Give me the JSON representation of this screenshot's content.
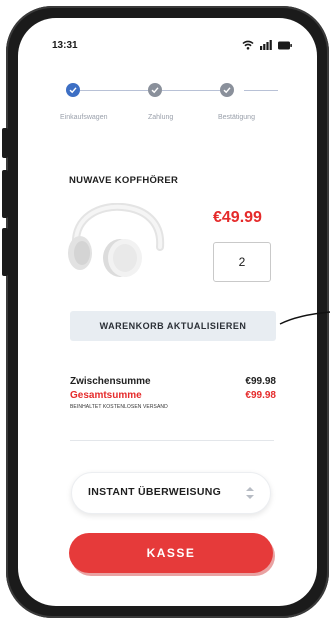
{
  "status_bar": {
    "time": "13:31"
  },
  "stepper": {
    "steps": [
      {
        "label": "Einkaufswagen",
        "state": "completed"
      },
      {
        "label": "Zahlung",
        "state": "pending"
      },
      {
        "label": "Bestätigung",
        "state": "pending"
      }
    ]
  },
  "product": {
    "name": "NUWAVE KOPFHÖRER",
    "price": "€49.99",
    "quantity": "2",
    "image_icon": "headphones-icon"
  },
  "cart": {
    "update_label": "WARENKORB AKTUALISIEREN"
  },
  "summary": {
    "subtotal_label": "Zwischensumme",
    "subtotal_value": "€99.98",
    "total_label": "Gesamtsumme",
    "total_value": "€99.98",
    "shipping_note": "BEINHALTET KOSTENLOSEN VERSAND"
  },
  "payment": {
    "selected": "INSTANT ÜBERWEISUNG"
  },
  "checkout": {
    "label": "KASSE"
  },
  "colors": {
    "accent": "#e63a3a",
    "price": "#e52b2b",
    "step_complete": "#3d6fc4",
    "step_pending": "#8a909b",
    "update_button_bg": "#e8edf2"
  }
}
